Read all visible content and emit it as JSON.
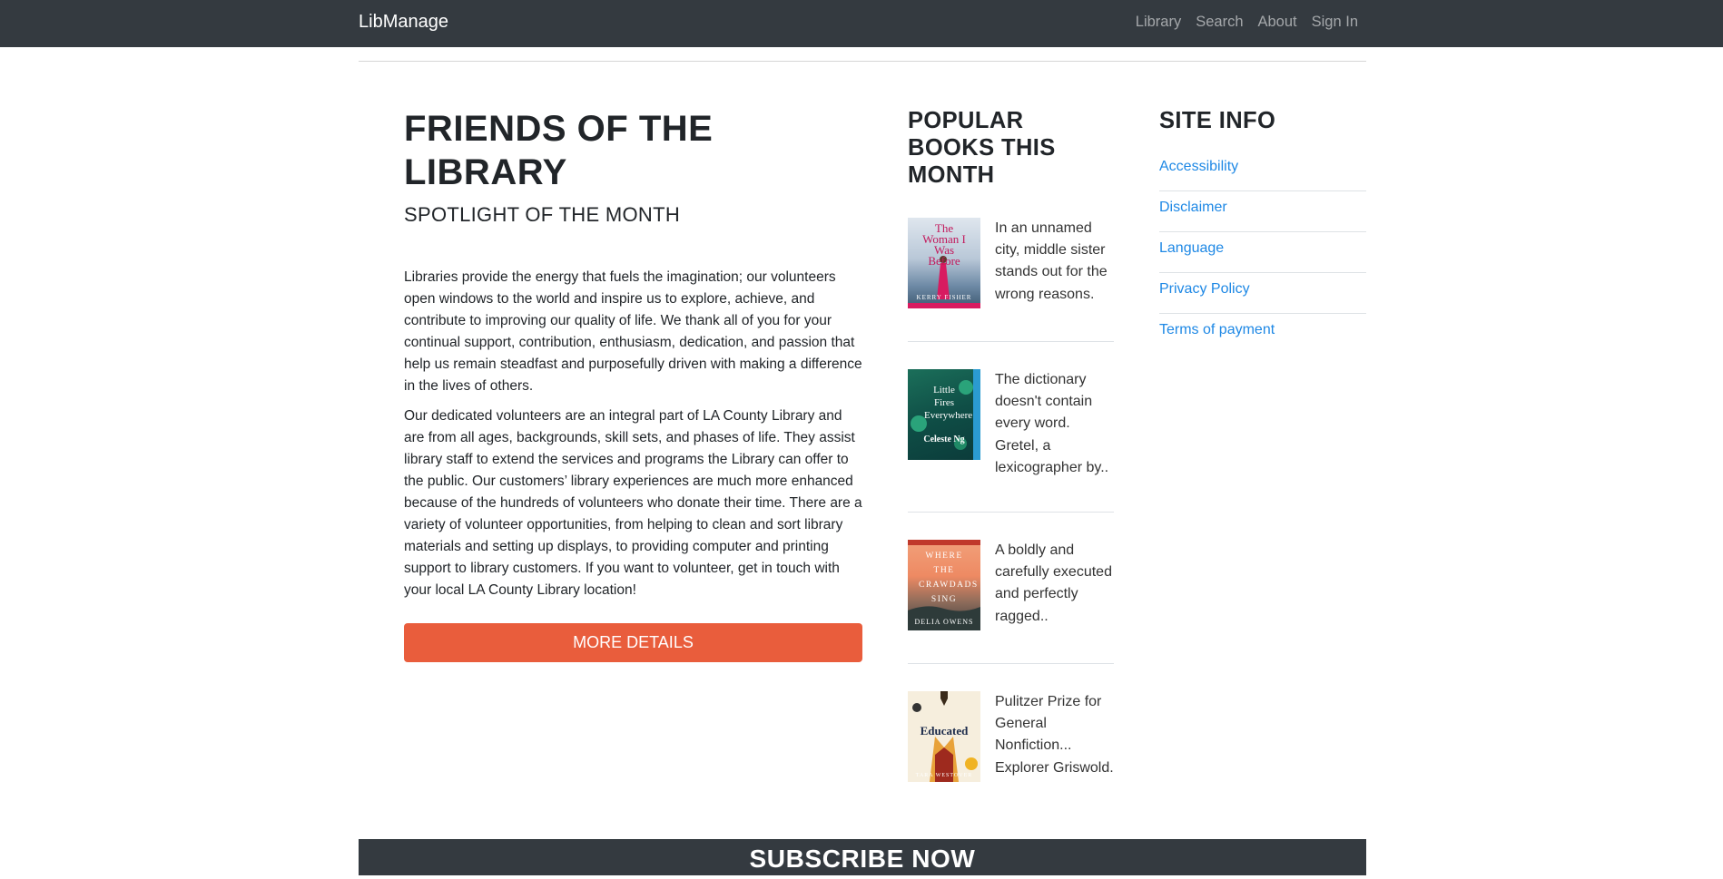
{
  "navbar": {
    "brand": "LibManage",
    "links": [
      "Library",
      "Search",
      "About",
      "Sign In"
    ]
  },
  "main": {
    "title": "FRIENDS OF THE LIBRARY",
    "subtitle": "SPOTLIGHT OF THE MONTH",
    "paragraph1": "Libraries provide the energy that fuels the imagination; our volunteers open windows to the world and inspire us to explore, achieve, and contribute to improving our quality of life. We thank all of you for your continual support, contribution, enthusiasm, dedication, and passion that help us remain steadfast and purposefully driven with making a difference in the lives of others.",
    "paragraph2": "Our dedicated volunteers are an integral part of LA County Library and are from all ages, backgrounds, skill sets, and phases of life. They assist library staff to extend the services and programs the Library can offer to the public. Our customers’ library experiences are much more enhanced because of the hundreds of volunteers who donate their time. There are a variety of volunteer opportunities, from helping to clean and sort library materials and setting up displays, to providing computer and printing support to library customers. If you want to volunteer, get in touch with your local LA County Library location!",
    "button_label": "MORE DETAILS"
  },
  "popular": {
    "title": "POPULAR BOOKS THIS MONTH",
    "books": [
      {
        "description": "In an unnamed city, middle sister stands out for the wrong reasons.",
        "cover_title": "The Woman I Was Before",
        "cover_author": "KERRY FISHER"
      },
      {
        "description": "The dictionary doesn't contain every word. Gretel, a lexicographer by..",
        "cover_title": "Little Fires Everywhere",
        "cover_author": "Celeste Ng"
      },
      {
        "description": "A boldly and carefully executed and perfectly ragged..",
        "cover_title": "WHERE THE CRAWDADS SING",
        "cover_author": "DELIA OWENS"
      },
      {
        "description": "Pulitzer Prize for General Nonfiction... Explorer Griswold.",
        "cover_title": "Educated",
        "cover_author": "TARA WESTOVER"
      }
    ]
  },
  "site_info": {
    "title": "SITE INFO",
    "links": [
      "Accessibility",
      "Disclaimer",
      "Language",
      "Privacy Policy",
      "Terms of payment"
    ]
  },
  "subscribe": {
    "title": "SUBSCRIBE NOW"
  },
  "colors": {
    "navbar_bg": "#343a40",
    "accent_button": "#e95d3c",
    "link": "#1e88e5"
  }
}
